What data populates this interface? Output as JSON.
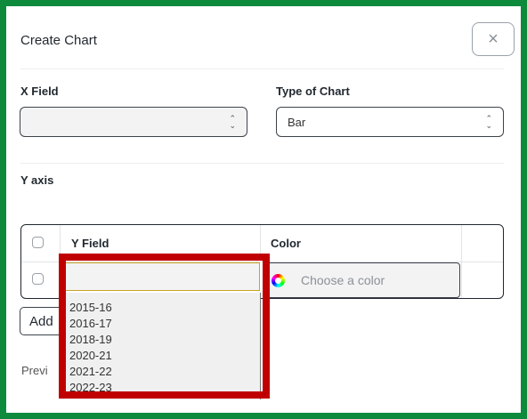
{
  "dialog": {
    "title": "Create Chart",
    "close_icon": "×"
  },
  "form": {
    "x_field": {
      "label": "X Field",
      "value": ""
    },
    "chart_type": {
      "label": "Type of Chart",
      "value": "Bar"
    },
    "y_axis_label": "Y axis"
  },
  "grid": {
    "columns": [
      "Y Field",
      "Color"
    ],
    "row": {
      "y_field_value": "",
      "color_placeholder": "Choose a color"
    }
  },
  "add_button_label": "Add",
  "preview_label": "Previ",
  "dropdown": {
    "options": [
      "2015-16",
      "2016-17",
      "2018-19",
      "2020-21",
      "2021-22",
      "2022-23"
    ]
  },
  "colors": {
    "frame_border": "#0e8a3d",
    "highlight_border": "#c00000"
  }
}
